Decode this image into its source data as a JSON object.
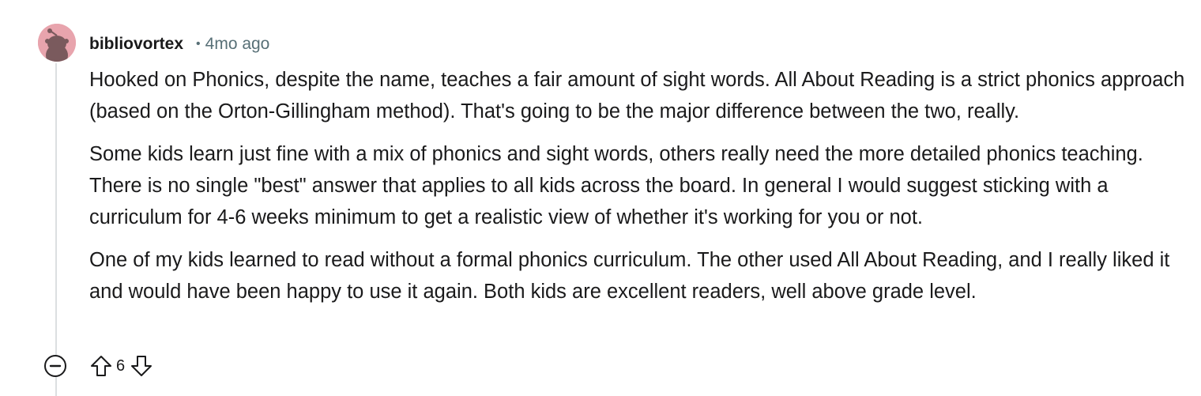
{
  "comment": {
    "author": "bibliovortex",
    "separator": "•",
    "age": "4mo ago",
    "paragraphs": [
      "Hooked on Phonics, despite the name, teaches a fair amount of sight words. All About Reading is a strict phonics approach (based on the Orton-Gillingham method). That's going to be the major difference between the two, really.",
      "Some kids learn just fine with a mix of phonics and sight words, others really need the more detailed phonics teaching. There is no single \"best\" answer that applies to all kids across the board. In general I would suggest sticking with a curriculum for 4-6 weeks minimum to get a realistic view of whether it's working for you or not.",
      "One of my kids learned to read without a formal phonics curriculum. The other used All About Reading, and I really liked it and would have been happy to use it again. Both kids are excellent readers, well above grade level."
    ],
    "score": "6"
  },
  "icons": {
    "avatar": "snoo-avatar-icon",
    "collapse": "collapse-minus-icon",
    "upvote": "upvote-arrow-icon",
    "downvote": "downvote-arrow-icon"
  },
  "colors": {
    "avatar_bg": "#e8a4ad",
    "avatar_figure": "#7a5a5d",
    "meta_text": "#576f76",
    "thread_line": "#dcdfe1",
    "text": "#1a1a1b"
  }
}
